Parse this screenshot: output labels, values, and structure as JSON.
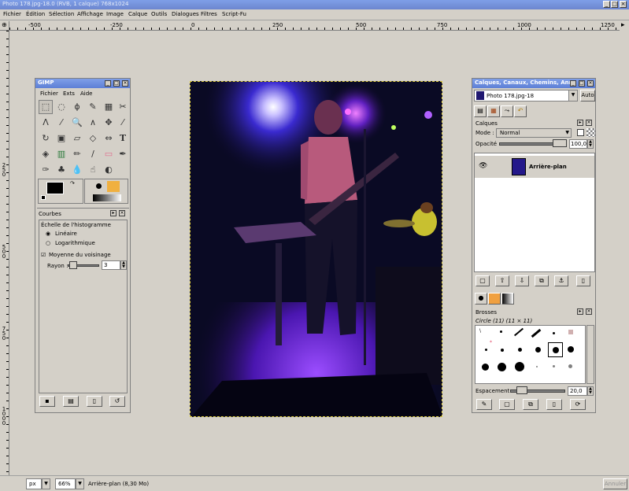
{
  "window": {
    "title": "Photo 178.jpg-18.0 (RVB, 1 calque) 768x1024"
  },
  "menu": [
    "Fichier",
    "Édition",
    "Sélection",
    "Affichage",
    "Image",
    "Calque",
    "Outils",
    "Dialogues",
    "Filtres",
    "Script-Fu"
  ],
  "ruler_top": [
    "-500",
    "-250",
    "0",
    "250",
    "500",
    "750",
    "1000",
    "1250"
  ],
  "ruler_left": [
    "2\n5\n0",
    "5\n0\n0",
    "7\n5\n0",
    "1\n0\n0\n0"
  ],
  "toolbox": {
    "title": "GIMP",
    "menu": [
      "Fichier",
      "Exts",
      "Aide"
    ]
  },
  "curves": {
    "title": "Courbes",
    "histogram_scale_label": "Échelle de l'histogramme",
    "linear_label": "Linéaire",
    "log_label": "Logarithmique",
    "neighborhood_label": "Moyenne du voisinage",
    "radius_label": "Rayon :",
    "radius_value": "3"
  },
  "layers": {
    "title": "Calques, Canaux, Chemins, Ann",
    "image_select": "Photo 178.jpg-18",
    "auto_label": "Auto",
    "section_label": "Calques",
    "mode_label": "Mode :",
    "mode_value": "Normal",
    "opacity_label": "Opacité :",
    "opacity_value": "100,0",
    "layer_name": "Arrière-plan"
  },
  "brushes": {
    "section_label": "Brosses",
    "current": "Circle (11) (11 × 11)",
    "spacing_label": "Espacement :",
    "spacing_value": "20,0"
  },
  "status": {
    "unit": "px",
    "zoom": "66%",
    "info": "Arrière-plan (8,30 Mo)",
    "cancel": "Annuler"
  }
}
